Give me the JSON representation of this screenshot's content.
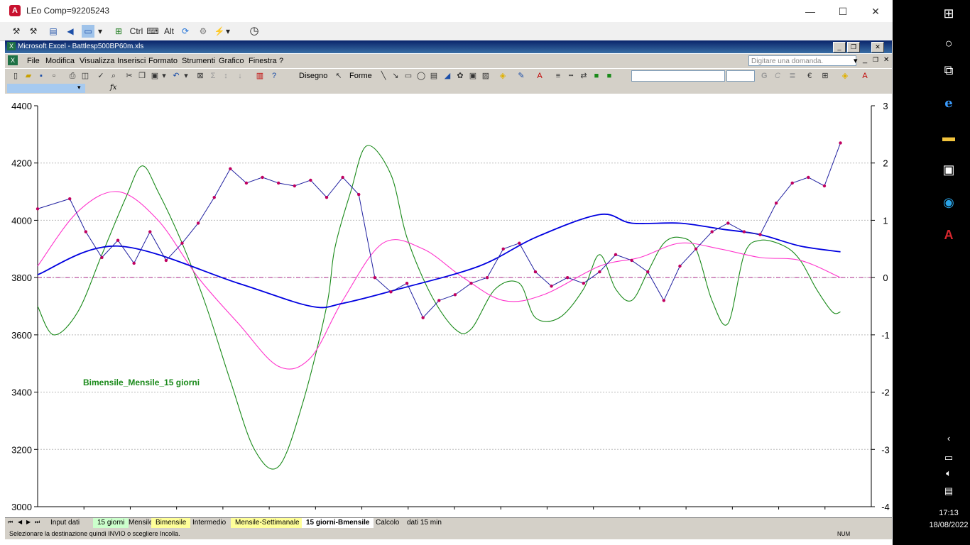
{
  "window": {
    "title": "LEo Comp=92205243",
    "minimize": "—",
    "maximize": "☐",
    "close": "✕"
  },
  "app_toolbar": {
    "ctrl_label": "Ctrl",
    "alt_label": "Alt"
  },
  "excel": {
    "title": "Microsoft Excel - Battlesp500BP60m.xls",
    "menu": [
      "File",
      "Modifica",
      "Visualizza",
      "Inserisci",
      "Formato",
      "Strumenti",
      "Grafico",
      "Finestra",
      "?"
    ],
    "ask_placeholder": "Digitare una domanda.",
    "draw_label": "Disegno",
    "shapes_label": "Forme",
    "fx_label": "fx",
    "bold": "G",
    "italic": "C"
  },
  "chart_data": {
    "type": "line",
    "annotation": "Bimensile_Mensile_15 giorni",
    "y_left": {
      "min": 3000,
      "max": 4400,
      "ticks": [
        "4400",
        "4200",
        "4000",
        "3800",
        "3600",
        "3400",
        "3200",
        "3000"
      ]
    },
    "y_right": {
      "min": -4,
      "max": 3,
      "ticks": [
        "3",
        "2",
        "1",
        "0",
        "-1",
        "-2",
        "-3",
        "-4"
      ]
    },
    "grid": true,
    "colors": {
      "price": "#c00060",
      "blue": "#0000e0",
      "magenta": "#ff33cc",
      "green": "#1a8a1a",
      "zero": "#b03090"
    },
    "price_x": [
      0,
      4,
      6,
      8,
      10,
      12,
      14,
      16,
      18,
      20,
      22,
      24,
      26,
      28,
      30,
      32,
      34,
      36,
      38,
      40,
      42,
      44,
      46,
      48,
      50,
      52,
      54,
      56,
      58,
      60,
      62,
      64,
      66,
      68,
      70,
      72,
      74,
      76,
      78,
      80,
      82,
      84,
      86,
      88,
      90,
      92,
      94,
      96,
      98,
      100
    ],
    "price": [
      4040,
      4075,
      3960,
      3870,
      3930,
      3850,
      3960,
      3860,
      3920,
      3990,
      4080,
      4180,
      4130,
      4150,
      4130,
      4120,
      4140,
      4080,
      4150,
      4090,
      3800,
      3750,
      3780,
      3660,
      3720,
      3740,
      3780,
      3800,
      3900,
      3920,
      3820,
      3770,
      3800,
      3780,
      3820,
      3880,
      3860,
      3820,
      3720,
      3840,
      3900,
      3960,
      3990,
      3960,
      3950,
      4060,
      4130,
      4150,
      4120,
      4270
    ],
    "blue_x": [
      0,
      10,
      25,
      34,
      38,
      45,
      55,
      62,
      70,
      74,
      80,
      85,
      90,
      95,
      100
    ],
    "blue": [
      0.05,
      0.55,
      -0.1,
      -0.5,
      -0.45,
      -0.2,
      0.2,
      0.7,
      1.1,
      0.95,
      0.95,
      0.85,
      0.75,
      0.55,
      0.45
    ],
    "magenta_x": [
      0,
      5,
      10,
      15,
      20,
      25,
      30,
      34,
      38,
      43,
      48,
      53,
      58,
      63,
      70,
      75,
      80,
      85,
      90,
      95,
      100
    ],
    "magenta": [
      0.2,
      1.15,
      1.5,
      1.0,
      0.0,
      -0.8,
      -1.55,
      -1.4,
      -0.4,
      0.6,
      0.5,
      0.0,
      -0.4,
      -0.3,
      0.2,
      0.35,
      0.6,
      0.5,
      0.35,
      0.3,
      0.0
    ],
    "green_x": [
      0,
      2,
      5,
      8,
      11,
      13,
      15,
      18,
      21,
      24,
      27,
      30,
      33,
      36,
      37,
      39,
      41,
      44,
      46,
      49,
      52,
      54,
      57,
      60,
      62,
      65,
      68,
      70,
      72,
      74,
      76,
      78,
      80,
      82,
      84,
      86,
      88,
      90,
      93,
      95,
      97,
      99,
      100
    ],
    "green": [
      -0.5,
      -1.0,
      -0.6,
      0.4,
      1.4,
      1.95,
      1.5,
      0.6,
      -0.5,
      -1.8,
      -3.0,
      -3.3,
      -2.2,
      -0.5,
      0.5,
      1.5,
      2.3,
      1.8,
      0.7,
      -0.3,
      -0.9,
      -0.9,
      -0.2,
      -0.1,
      -0.7,
      -0.7,
      -0.2,
      0.4,
      -0.2,
      -0.4,
      0.1,
      0.6,
      0.7,
      0.5,
      -0.4,
      -0.8,
      0.4,
      0.65,
      0.55,
      0.3,
      -0.2,
      -0.6,
      -0.6
    ]
  },
  "sheet_tabs": [
    {
      "label": "Input dati",
      "kind": ""
    },
    {
      "label": "15 giorni",
      "kind": "green"
    },
    {
      "label": "Mensile",
      "kind": ""
    },
    {
      "label": "Bimensile",
      "kind": "yellow"
    },
    {
      "label": "Intermedio",
      "kind": ""
    },
    {
      "label": "Mensile-Settimanale",
      "kind": "yellow"
    },
    {
      "label": "15 giorni-Bmensile",
      "kind": "active"
    },
    {
      "label": "Calcolo",
      "kind": ""
    },
    {
      "label": "dati 15 min",
      "kind": ""
    }
  ],
  "status": {
    "message": "Selezionare la destinazione quindi INVIO o scegliere Incolla.",
    "num": "NUM"
  },
  "taskbar": {
    "time": "17:13",
    "date": "18/08/2022"
  }
}
